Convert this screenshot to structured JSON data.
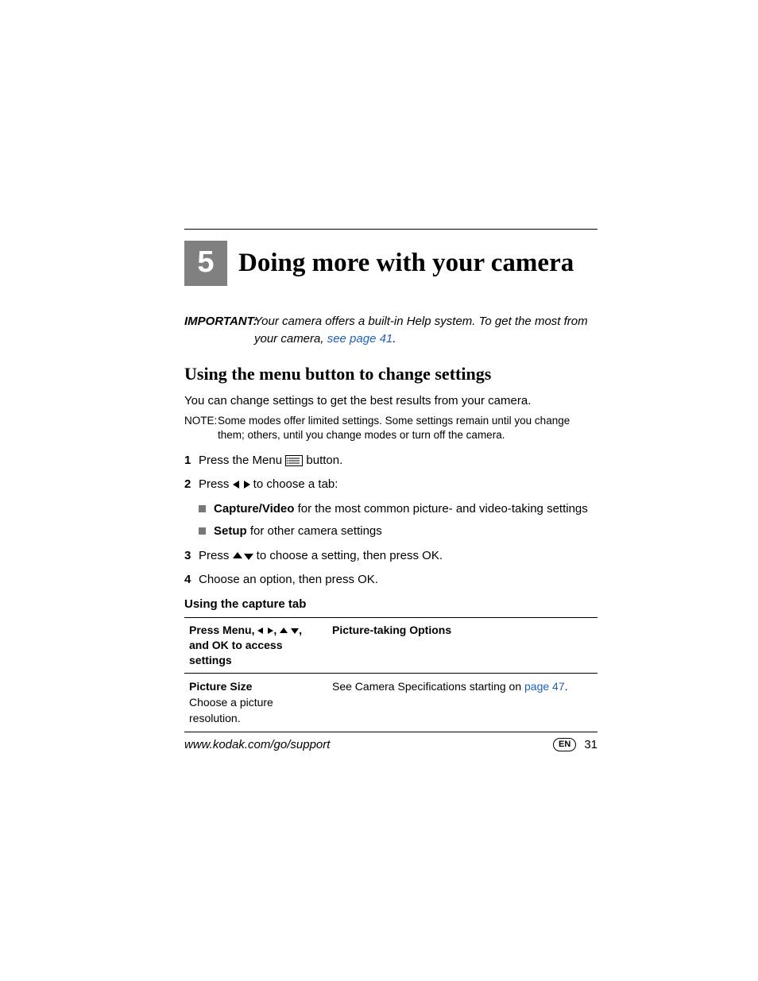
{
  "chapter": {
    "number": "5",
    "title": "Doing more with your camera"
  },
  "important": {
    "label": "IMPORTANT:",
    "text_a": "Your camera offers a built-in Help system. To get the most from your camera, ",
    "link": "see page 41",
    "text_b": "."
  },
  "section": {
    "heading": "Using the menu button to change settings"
  },
  "intro": "You can change settings to get the best results from your camera.",
  "note": {
    "label": "NOTE:",
    "text": "Some modes offer limited settings. Some settings remain until you change them; others, until you change modes or turn off the camera."
  },
  "steps": {
    "s1": {
      "n": "1",
      "a": "Press the Menu ",
      "b": " button."
    },
    "s2": {
      "n": "2",
      "a": "Press ",
      "b": " to choose a tab:"
    },
    "s3": {
      "n": "3",
      "a": "Press ",
      "b": " to choose a setting, then press OK."
    },
    "s4": {
      "n": "4",
      "a": "Choose an option, then press OK."
    }
  },
  "bullets": {
    "b1": {
      "strong": "Capture/Video",
      "rest": " for the most common picture- and video-taking settings"
    },
    "b2": {
      "strong": "Setup",
      "rest": " for other camera settings"
    }
  },
  "subheading": "Using the capture tab",
  "table": {
    "th1_a": "Press Menu, ",
    "th1_b": ", ",
    "th1_c": ", and OK to access settings",
    "th2": "Picture-taking Options",
    "row1": {
      "left_strong": "Picture Size",
      "left_sub": "Choose a picture resolution.",
      "right_a": "See Camera Specifications starting on ",
      "right_link": "page 47",
      "right_b": "."
    }
  },
  "footer": {
    "url": "www.kodak.com/go/support",
    "lang": "EN",
    "page": "31"
  }
}
